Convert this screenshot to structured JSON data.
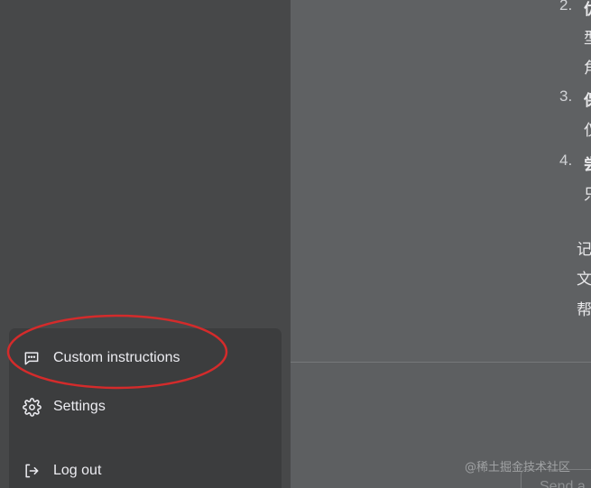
{
  "menu": {
    "custom_instructions": "Custom instructions",
    "settings": "Settings",
    "logout": "Log out",
    "icons": {
      "custom_instructions": "chat-bubble-dots-icon",
      "settings": "gear-icon",
      "logout": "logout-arrow-icon"
    }
  },
  "chat": {
    "items": [
      {
        "number": "2.",
        "title": "优",
        "lines": [
          "型",
          "角"
        ]
      },
      {
        "number": "3.",
        "title": "保",
        "lines": [
          "仅"
        ]
      },
      {
        "number": "4.",
        "title": "尝",
        "lines": [
          "只"
        ]
      }
    ],
    "paragraph": [
      "记",
      "文",
      "帮"
    ]
  },
  "input": {
    "placeholder": "Send a"
  },
  "watermark": "@稀土掘金技术社区",
  "colors": {
    "highlight": "#d42b2b",
    "menu_bg": "#3c3d3e",
    "sidebar_bg": "#474849",
    "main_bg": "#5f6163"
  }
}
